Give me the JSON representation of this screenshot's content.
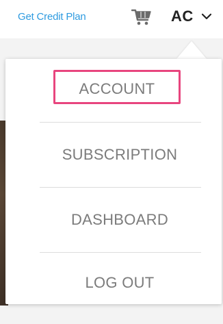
{
  "header": {
    "credit_link": "Get Credit Plan",
    "cart_icon": "shopping-cart-icon",
    "user_initials": "AC",
    "dropdown_icon": "chevron-down-icon"
  },
  "user_menu": {
    "items": [
      {
        "label": "ACCOUNT",
        "highlighted": true
      },
      {
        "label": "SUBSCRIPTION",
        "highlighted": false
      },
      {
        "label": "DASHBOARD",
        "highlighted": false
      },
      {
        "label": "LOG OUT",
        "highlighted": false
      }
    ],
    "highlight_color": "#e8457e"
  },
  "colors": {
    "link": "#2e9be0",
    "menu_text": "#7b7b7b",
    "initials": "#222222"
  }
}
